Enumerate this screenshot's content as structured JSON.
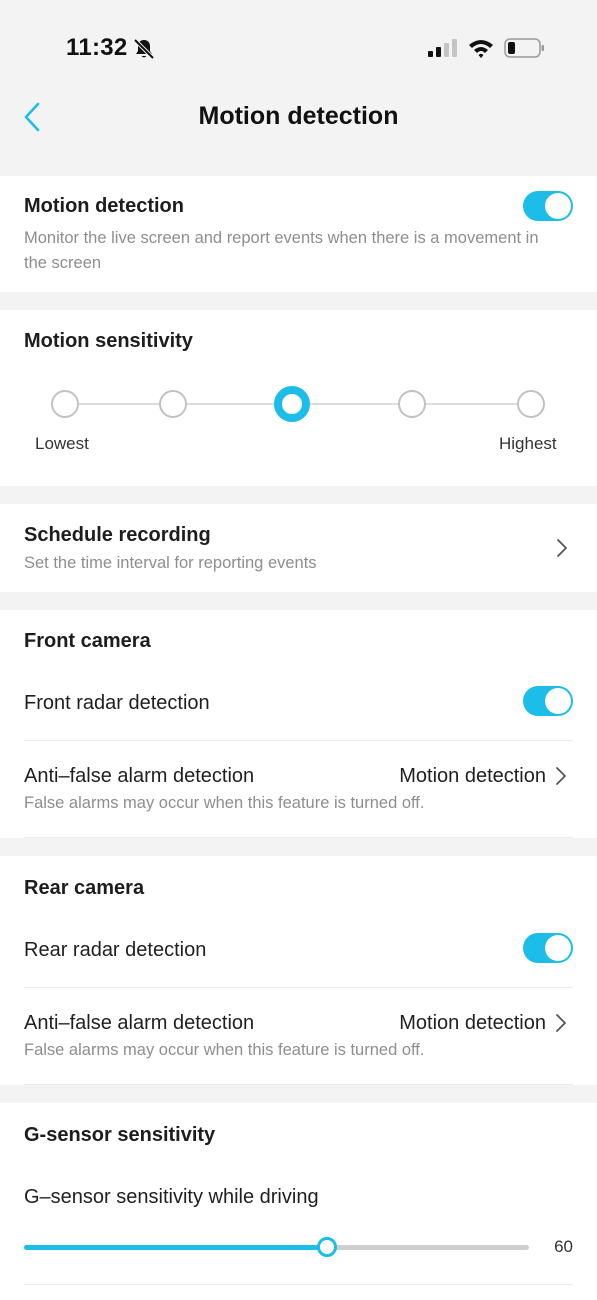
{
  "status": {
    "time": "11:32",
    "icons": [
      "bell-slash-icon",
      "cellular-signal-icon",
      "wifi-icon",
      "battery-icon"
    ]
  },
  "nav": {
    "back_icon": "chevron-left-icon",
    "title": "Motion detection"
  },
  "motion_detection": {
    "title": "Motion detection",
    "description": "Monitor the live screen and report events when there is a movement in the screen",
    "enabled": true
  },
  "motion_sensitivity": {
    "title": "Motion sensitivity",
    "levels": 5,
    "selected_level": 3,
    "min_label": "Lowest",
    "max_label": "Highest"
  },
  "schedule_recording": {
    "title": "Schedule recording",
    "description": "Set the time interval for reporting events"
  },
  "front_camera": {
    "title": "Front camera",
    "radar_label": "Front radar detection",
    "radar_enabled": true,
    "anti_false_label": "Anti–false alarm detection",
    "anti_false_value": "Motion detection",
    "anti_false_note": "False alarms may occur when this feature is turned off."
  },
  "rear_camera": {
    "title": "Rear camera",
    "radar_label": "Rear radar detection",
    "radar_enabled": true,
    "anti_false_label": "Anti–false alarm detection",
    "anti_false_value": "Motion detection",
    "anti_false_note": "False alarms may occur when this feature is turned off."
  },
  "g_sensor": {
    "title": "G-sensor sensitivity",
    "driving_label": "G–sensor sensitivity while driving",
    "driving_value": "60",
    "driving_fraction": 0.6
  },
  "colors": {
    "accent": "#1dbde9",
    "background": "#f3f3f3",
    "card": "#ffffff"
  }
}
